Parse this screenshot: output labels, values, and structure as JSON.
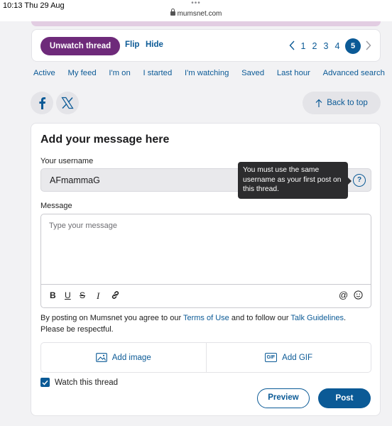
{
  "status_bar": {
    "time": "10:13",
    "date": "Thu 29 Aug",
    "dots": "•••",
    "url": "mumsnet.com"
  },
  "thread_bar": {
    "unwatch_label": "Unwatch thread",
    "flip_label": "Flip",
    "hide_label": "Hide",
    "pages": [
      "1",
      "2",
      "3",
      "4",
      "5"
    ],
    "current_page": "5",
    "prev_icon": "chevron-left-icon",
    "next_icon": "chevron-right-icon"
  },
  "subnav": {
    "items": [
      "Active",
      "My feed",
      "I'm on",
      "I started",
      "I'm watching",
      "Saved",
      "Last hour",
      "Advanced search"
    ]
  },
  "social": {
    "facebook_icon": "facebook-icon",
    "x_icon": "x-icon"
  },
  "back_to_top": {
    "label": "Back to top",
    "icon": "arrow-up-icon"
  },
  "compose": {
    "title": "Add your message here",
    "username_label": "Your username",
    "username_value": "AFmammaG",
    "tooltip": "You must use the same username as your first post on this thread.",
    "help_glyph": "?",
    "message_label": "Message",
    "message_placeholder": "Type your message",
    "toolbar": {
      "bold": "B",
      "underline": "U",
      "strike": "S",
      "italic": "I",
      "at": "@"
    },
    "terms_prefix": "By posting on Mumsnet you agree to our ",
    "terms_link": "Terms of Use",
    "terms_middle": " and to follow our ",
    "guidelines_link": "Talk Guidelines",
    "terms_suffix": ". Please be respectful.",
    "add_image_label": "Add image",
    "add_gif_label": "Add GIF",
    "gif_badge": "GIF",
    "watch_label": "Watch this thread",
    "watch_checked": true,
    "preview_label": "Preview",
    "post_label": "Post"
  },
  "colors": {
    "accent_blue": "#0b5a96",
    "purple": "#6e2a7a",
    "notice_pink": "#e2cde2"
  }
}
